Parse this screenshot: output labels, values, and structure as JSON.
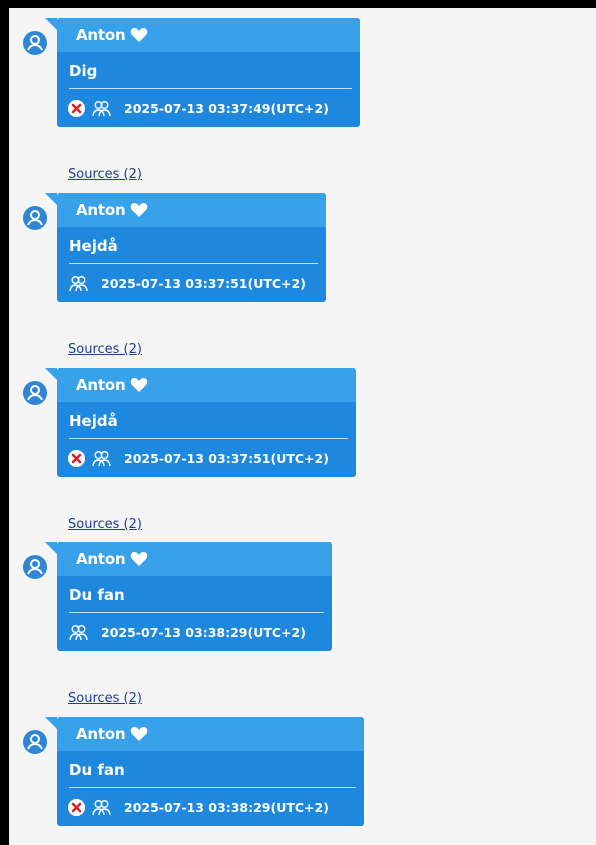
{
  "messages": [
    {
      "sender": "Anton",
      "text": "Dig",
      "deleted": true,
      "timestamp": "2025-07-13 03:37:49(UTC+2)",
      "sources_label": "Sources (2)"
    },
    {
      "sender": "Anton",
      "text": "Hejdå",
      "deleted": false,
      "timestamp": "2025-07-13 03:37:51(UTC+2)",
      "sources_label": "Sources (2)"
    },
    {
      "sender": "Anton",
      "text": "Hejdå",
      "deleted": true,
      "timestamp": "2025-07-13 03:37:51(UTC+2)",
      "sources_label": "Sources (2)"
    },
    {
      "sender": "Anton",
      "text": "Du fan",
      "deleted": false,
      "timestamp": "2025-07-13 03:38:29(UTC+2)",
      "sources_label": "Sources (2)"
    },
    {
      "sender": "Anton",
      "text": "Du fan",
      "deleted": true,
      "timestamp": "2025-07-13 03:38:29(UTC+2)",
      "sources_label": "Sources (2)"
    }
  ],
  "icons": {
    "avatar": "user-avatar-icon",
    "heart": "heart-icon",
    "deleted": "deleted-x-icon",
    "participants": "participants-icon"
  },
  "colors": {
    "bubble_body": "#1e88de",
    "bubble_header": "#37a2ea",
    "avatar": "#2f86d6",
    "deleted_x": "#d8232a",
    "link": "#1f3f8f",
    "background": "#f5f5f5",
    "border": "#000000"
  }
}
